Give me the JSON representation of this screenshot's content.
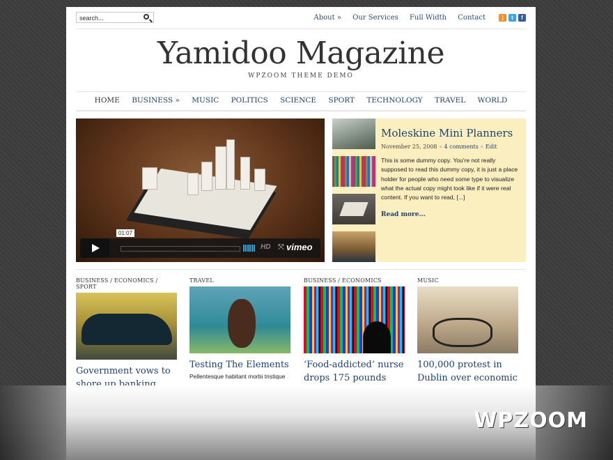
{
  "search": {
    "placeholder": "search..."
  },
  "top_nav": [
    "About »",
    "Our Services",
    "Full Width",
    "Contact"
  ],
  "social_icons": [
    "rss-icon",
    "twitter-icon",
    "facebook-icon"
  ],
  "site": {
    "title": "Yamidoo Magazine",
    "tagline": "WPZOOM THEME DEMO"
  },
  "main_nav": [
    "HOME",
    "BUSINESS »",
    "MUSIC",
    "POLITICS",
    "SCIENCE",
    "SPORT",
    "TECHNOLOGY",
    "TRAVEL",
    "WORLD"
  ],
  "video": {
    "timecode": "01:07",
    "hd_label": "HD",
    "brand": "vimeo"
  },
  "featured": {
    "title": "Moleskine Mini Planners",
    "date": "November 25, 2008",
    "comments": "4 comments",
    "edit": "Edit",
    "excerpt": "This is some dummy copy. You're not really supposed to read this dummy copy, it is just a place holder for people who need some type to visualize what the actual copy might look like if it were real content. If you want to read, [...]",
    "more": "Read more..."
  },
  "posts": [
    {
      "category": "BUSINESS / ECONOMICS / SPORT",
      "title": "Government vows to shore up banking",
      "excerpt": ""
    },
    {
      "category": "TRAVEL",
      "title": "Testing The Elements",
      "excerpt": "Pellentesque habitant morbi tristique"
    },
    {
      "category": "BUSINESS / ECONOMICS",
      "title": "‘Food-addicted’ nurse drops 175 pounds",
      "excerpt": ""
    },
    {
      "category": "MUSIC",
      "title": "100,000 protest in Dublin over economic",
      "excerpt": ""
    }
  ],
  "watermark": "WPZOOM",
  "colors": {
    "link": "#1f4070",
    "featured_bg": "#fbefc0",
    "accent_vol": "#28a5d8"
  }
}
